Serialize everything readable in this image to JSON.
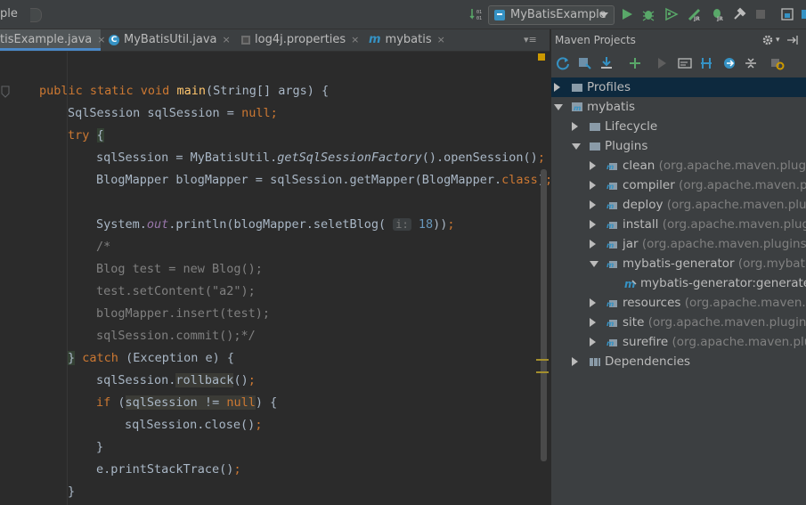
{
  "nav": {
    "breadcrumb": "ple",
    "run_config": "MyBatisExample"
  },
  "tabs": [
    {
      "label": "tisExample.java",
      "active": true
    },
    {
      "label": "MyBatisUtil.java"
    },
    {
      "label": "log4j.properties"
    },
    {
      "label": "mybatis"
    }
  ],
  "tab_overflow": "≡",
  "editor": {
    "lines": [
      "public static void main(String[] args) {",
      "SqlSession sqlSession = null;",
      "try {",
      "sqlSession = MyBatisUtil.getSqlSessionFactory().openSession();",
      "BlogMapper blogMapper = sqlSession.getMapper(BlogMapper.class);",
      "System.out.println(blogMapper.seletBlog( i: 18));",
      "/*",
      "Blog test = new Blog();",
      "test.setContent(\"a2\");",
      "blogMapper.insert(test);",
      "sqlSession.commit();*/",
      "} catch (Exception e) {",
      "sqlSession.rollback();",
      "if (sqlSession != null) {",
      "sqlSession.close();",
      "}",
      "e.printStackTrace();",
      "}"
    ],
    "param_hint": "i:",
    "param_value": "18"
  },
  "maven": {
    "title": "Maven Projects",
    "tree": [
      {
        "label": "Profiles",
        "detail": "",
        "expanded": false,
        "selected": true
      },
      {
        "label": "mybatis",
        "detail": "",
        "expanded": true
      },
      {
        "label": "Lifecycle",
        "detail": "",
        "expanded": false
      },
      {
        "label": "Plugins",
        "detail": "",
        "expanded": true
      },
      {
        "label": "clean",
        "detail": "(org.apache.maven.plugins:m",
        "expanded": false
      },
      {
        "label": "compiler",
        "detail": "(org.apache.maven.plugi",
        "expanded": false
      },
      {
        "label": "deploy",
        "detail": "(org.apache.maven.plugins",
        "expanded": false
      },
      {
        "label": "install",
        "detail": "(org.apache.maven.plugins:",
        "expanded": false
      },
      {
        "label": "jar",
        "detail": "(org.apache.maven.plugins:ma",
        "expanded": false
      },
      {
        "label": "mybatis-generator",
        "detail": "(org.mybatis.g",
        "expanded": true
      },
      {
        "label": "mybatis-generator:generate",
        "detail": ""
      },
      {
        "label": "resources",
        "detail": "(org.apache.maven.plug",
        "expanded": false
      },
      {
        "label": "site",
        "detail": "(org.apache.maven.plugins:ma",
        "expanded": false
      },
      {
        "label": "surefire",
        "detail": "(org.apache.maven.plugin",
        "expanded": false
      },
      {
        "label": "Dependencies",
        "detail": "",
        "expanded": false
      }
    ]
  },
  "colors": {
    "keyword": "#cc7832",
    "method": "#ffc66d",
    "number": "#6897bb",
    "comment": "#808080",
    "selection": "#0d293e"
  }
}
